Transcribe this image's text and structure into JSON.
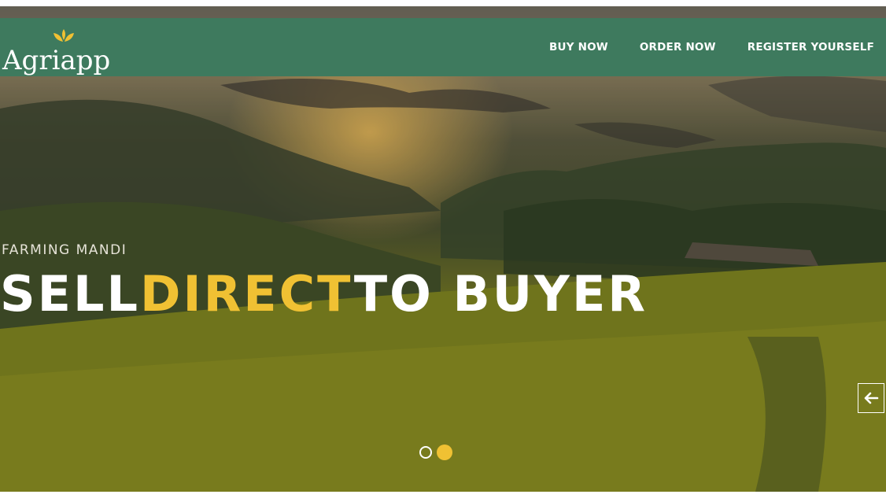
{
  "brand": {
    "name": "Agriapp",
    "accent_color": "#f0c133",
    "nav_color": "#3e7a5e"
  },
  "nav": {
    "items": [
      {
        "label": "BUY NOW"
      },
      {
        "label": "ORDER NOW"
      },
      {
        "label": "REGISTER YOURSELF"
      }
    ]
  },
  "hero": {
    "eyebrow": "FARMING MANDI",
    "headline_part1": "SELL",
    "headline_accent": "DIRECT",
    "headline_part2": "TO BUYER",
    "prev_icon": "arrow-left-icon"
  },
  "carousel": {
    "slide_count": 2,
    "active_index": 1
  }
}
